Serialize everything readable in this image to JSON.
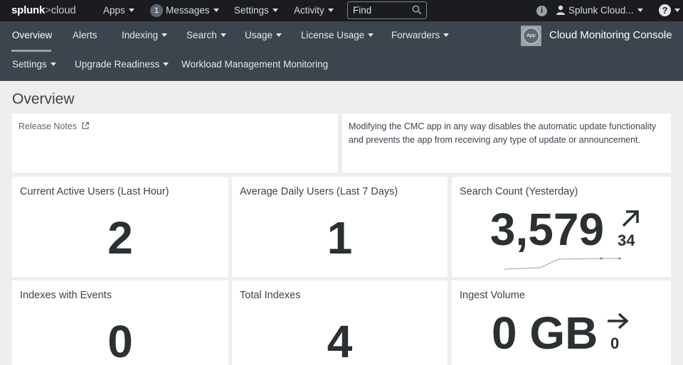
{
  "topbar": {
    "logo_main": "splunk",
    "logo_sep": ">",
    "logo_sub": "cloud",
    "apps": "Apps",
    "messages_count": "1",
    "messages": "Messages",
    "settings": "Settings",
    "activity": "Activity",
    "find_placeholder": "Find",
    "info_glyph": "i",
    "user": "Splunk Cloud...",
    "help_glyph": "?"
  },
  "appnav": {
    "items_row1": [
      "Overview",
      "Alerts",
      "Indexing",
      "Search",
      "Usage",
      "License Usage",
      "Forwarders"
    ],
    "items_row2": [
      "Settings",
      "Upgrade Readiness",
      "Workload Management Monitoring"
    ],
    "app_icon_label": "App",
    "app_title": "Cloud Monitoring Console"
  },
  "page": {
    "title": "Overview",
    "release_notes": "Release Notes",
    "notice": "Modifying the CMC app in any way disables the automatic update functionality and prevents the app from receiving any type of update or announcement."
  },
  "panels": [
    {
      "title": "Current Active Users (Last Hour)",
      "value": "2"
    },
    {
      "title": "Average Daily Users (Last 7 Days)",
      "value": "1"
    },
    {
      "title": "Search Count (Yesterday)",
      "value": "3,579",
      "delta": "34",
      "trend": "up"
    },
    {
      "title": "Indexes with Events",
      "value": "0"
    },
    {
      "title": "Total Indexes",
      "value": "4"
    },
    {
      "title": "Ingest Volume",
      "value": "0 GB",
      "delta": "0",
      "trend": "flat"
    }
  ],
  "colors": {
    "topbar": "#1a1c20",
    "appnav": "#3c444d",
    "page_bg": "#eeeeee",
    "panel_bg": "#ffffff"
  }
}
